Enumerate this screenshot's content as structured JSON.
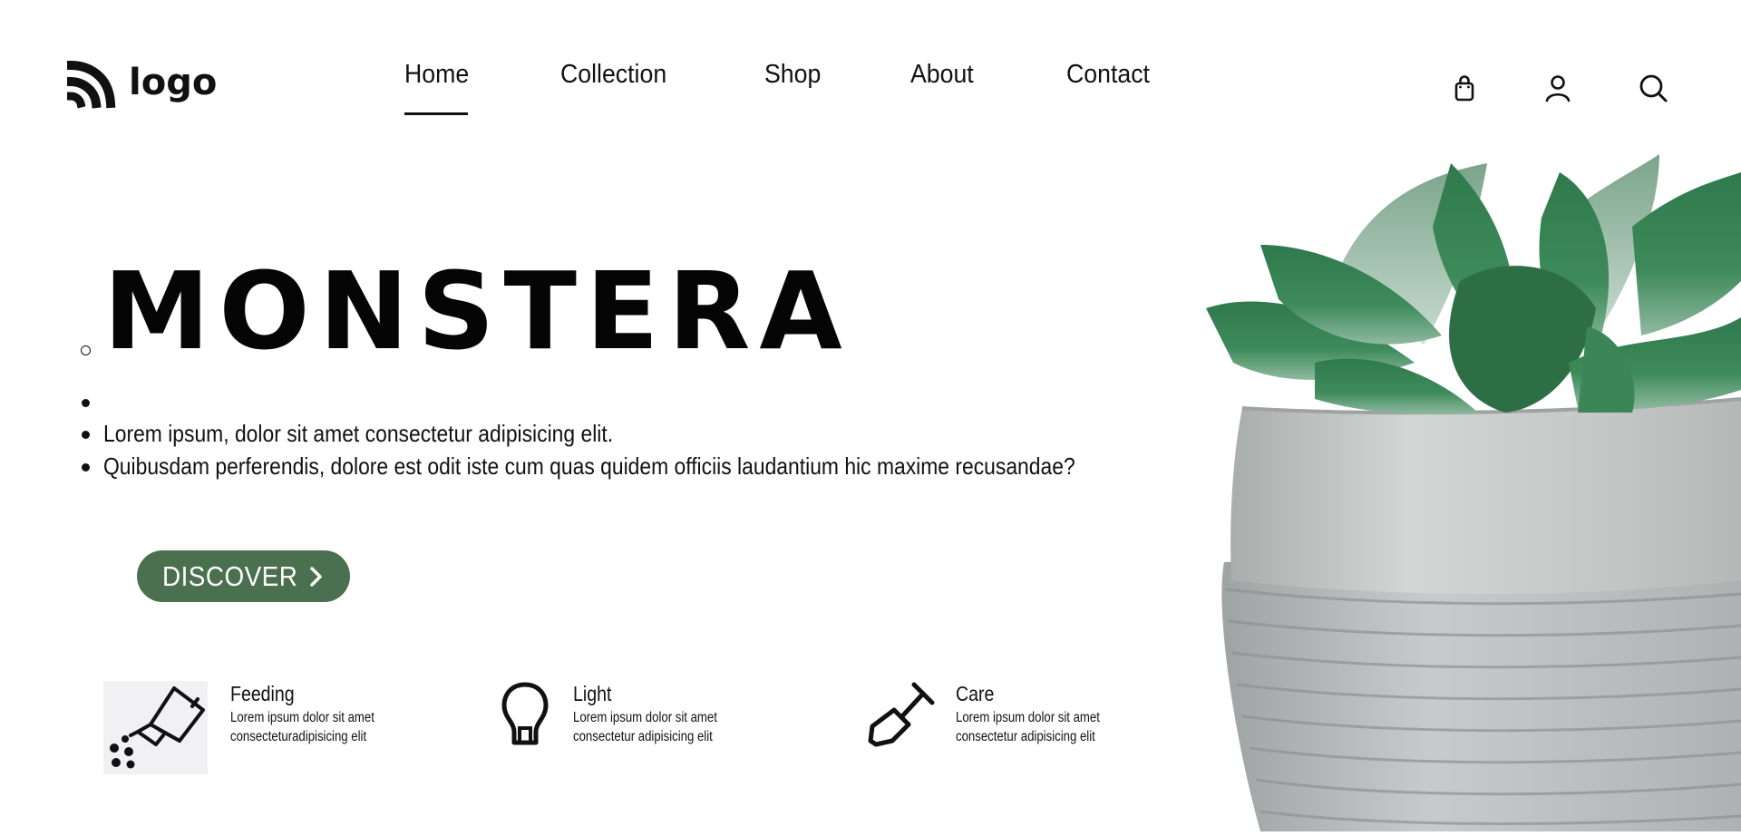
{
  "header": {
    "logo_text": "logo",
    "nav": [
      {
        "label": "Home",
        "active": true
      },
      {
        "label": "Collection",
        "active": false
      },
      {
        "label": "Shop",
        "active": false
      },
      {
        "label": "About",
        "active": false
      },
      {
        "label": "Contact",
        "active": false
      }
    ],
    "icons": [
      "shopping-bag-icon",
      "user-icon",
      "search-icon"
    ]
  },
  "hero": {
    "title": "MONSTERA",
    "bullets": [
      "",
      "Lorem ipsum, dolor sit amet consectetur adipisicing elit.",
      "Quibusdam perferendis, dolore est odit iste cum quas quidem officiis laudantium hic maxime recusandae?"
    ],
    "cta_label": "DISCOVER"
  },
  "features": [
    {
      "title": "Feeding",
      "desc_line1": "Lorem ipsum dolor sit amet",
      "desc_line2": "consecteturadipisicing elit",
      "icon": "watering-can-icon"
    },
    {
      "title": "Light",
      "desc_line1": "Lorem ipsum dolor sit amet",
      "desc_line2": "consectetur adipisicing elit",
      "icon": "light-bulb-icon"
    },
    {
      "title": "Care",
      "desc_line1": "Lorem ipsum dolor sit amet",
      "desc_line2": "consectetur adipisicing elit",
      "icon": "shovel-icon"
    }
  ],
  "colors": {
    "accent": "#4a7050",
    "text": "#111111",
    "background": "#ffffff"
  }
}
